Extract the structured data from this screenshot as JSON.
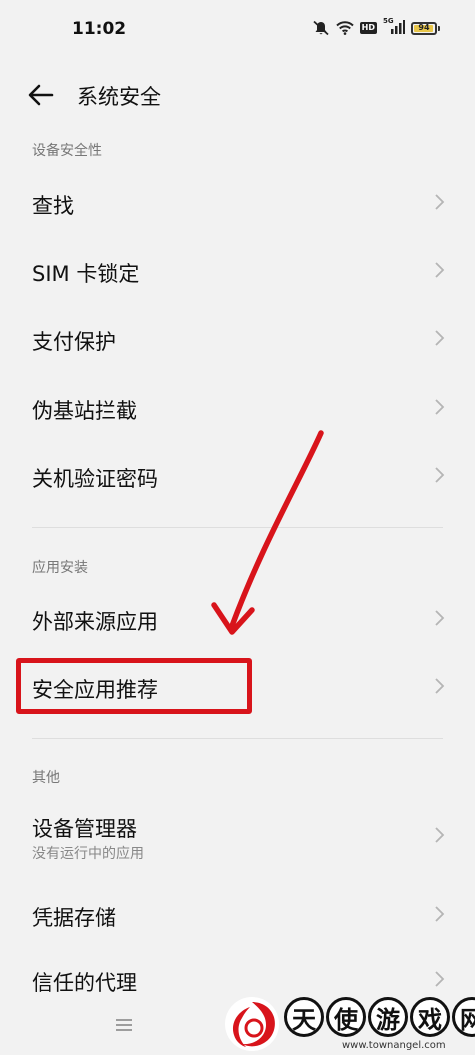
{
  "status_bar": {
    "time": "11:02",
    "battery_level": "94",
    "network_badge": "5G",
    "hd_badge": "HD",
    "icons": [
      "mute-icon",
      "wifi-icon",
      "hd-icon",
      "signal-icon",
      "battery-icon"
    ]
  },
  "header": {
    "title": "系统安全",
    "back_icon": "arrow-left-icon"
  },
  "sections": {
    "device_security": {
      "label": "设备安全性",
      "items": [
        {
          "label": "查找"
        },
        {
          "label": "SIM 卡锁定"
        },
        {
          "label": "支付保护"
        },
        {
          "label": "伪基站拦截"
        },
        {
          "label": "关机验证密码"
        }
      ]
    },
    "app_install": {
      "label": "应用安装",
      "items": [
        {
          "label": "外部来源应用"
        },
        {
          "label": "安全应用推荐"
        }
      ]
    },
    "other": {
      "label": "其他",
      "items": [
        {
          "label": "设备管理器",
          "sub": "没有运行中的应用"
        },
        {
          "label": "凭据存储"
        },
        {
          "label": "信任的代理"
        }
      ]
    }
  },
  "annotation": {
    "color": "#d8141b"
  },
  "watermark": {
    "chars": [
      "天",
      "使",
      "游",
      "戏",
      "网"
    ],
    "url": "www.townangel.com"
  }
}
